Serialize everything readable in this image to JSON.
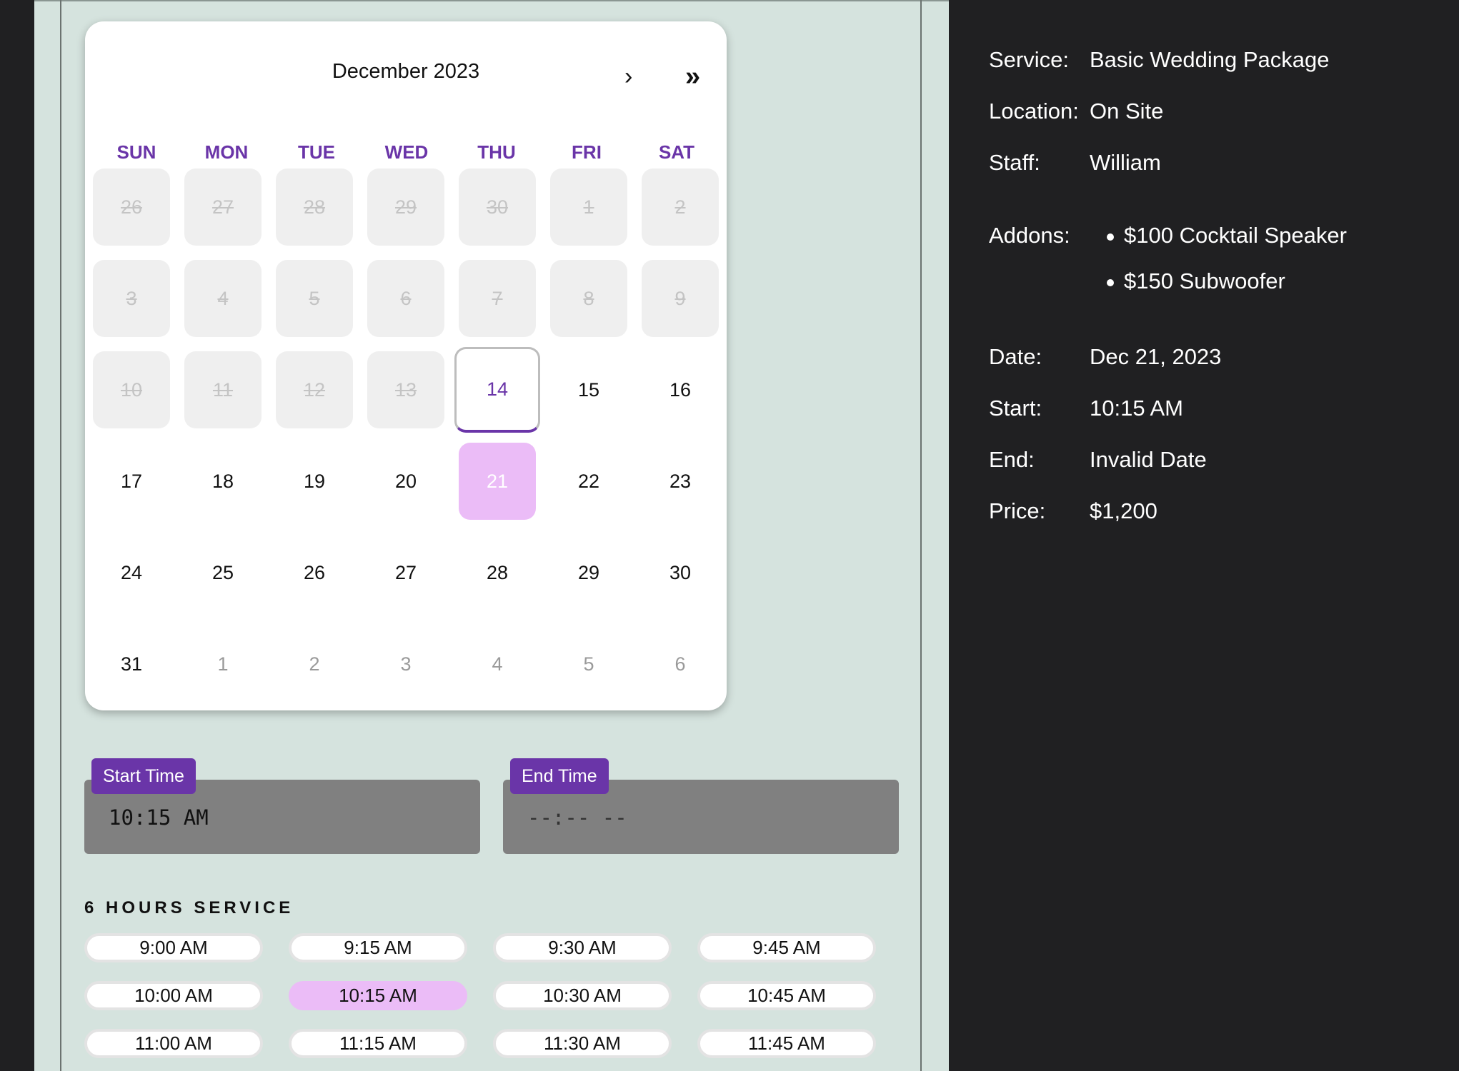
{
  "calendar": {
    "month_label": "December 2023",
    "next_label": "›",
    "next_year_label": "»",
    "weekdays": [
      "SUN",
      "MON",
      "TUE",
      "WED",
      "THU",
      "FRI",
      "SAT"
    ],
    "days": [
      "26",
      "27",
      "28",
      "29",
      "30",
      "1",
      "2",
      "3",
      "4",
      "5",
      "6",
      "7",
      "8",
      "9",
      "10",
      "11",
      "12",
      "13",
      "14",
      "15",
      "16",
      "17",
      "18",
      "19",
      "20",
      "21",
      "22",
      "23",
      "24",
      "25",
      "26",
      "27",
      "28",
      "29",
      "30",
      "31",
      "1",
      "2",
      "3",
      "4",
      "5",
      "6"
    ],
    "today": "14",
    "selected": "21"
  },
  "time_fields": {
    "start_label": "Start Time",
    "start_value": "10:15 AM",
    "end_label": "End Time",
    "end_value": "--:-- --"
  },
  "service": {
    "heading": "6 HOURS SERVICE",
    "slots": [
      "9:00 AM",
      "9:15 AM",
      "9:30 AM",
      "9:45 AM",
      "10:00 AM",
      "10:15 AM",
      "10:30 AM",
      "10:45 AM",
      "11:00 AM",
      "11:15 AM",
      "11:30 AM",
      "11:45 AM"
    ],
    "selected_slot": "10:15 AM"
  },
  "summary": {
    "service_label": "Service:",
    "service_value": "Basic Wedding Package",
    "location_label": "Location:",
    "location_value": "On Site",
    "staff_label": "Staff:",
    "staff_value": "William",
    "addons_label": "Addons:",
    "addons": [
      "$100 Cocktail Speaker",
      "$150 Subwoofer"
    ],
    "date_label": "Date:",
    "date_value": "Dec 21, 2023",
    "start_label": "Start:",
    "start_value": "10:15 AM",
    "end_label": "End:",
    "end_value": "Invalid Date",
    "price_label": "Price:",
    "price_value": "$1,200"
  },
  "colors": {
    "accent": "#6a35a8",
    "selected": "#ebbcf7",
    "panel_bg": "#d5e3de",
    "dark_bg": "#202022"
  }
}
